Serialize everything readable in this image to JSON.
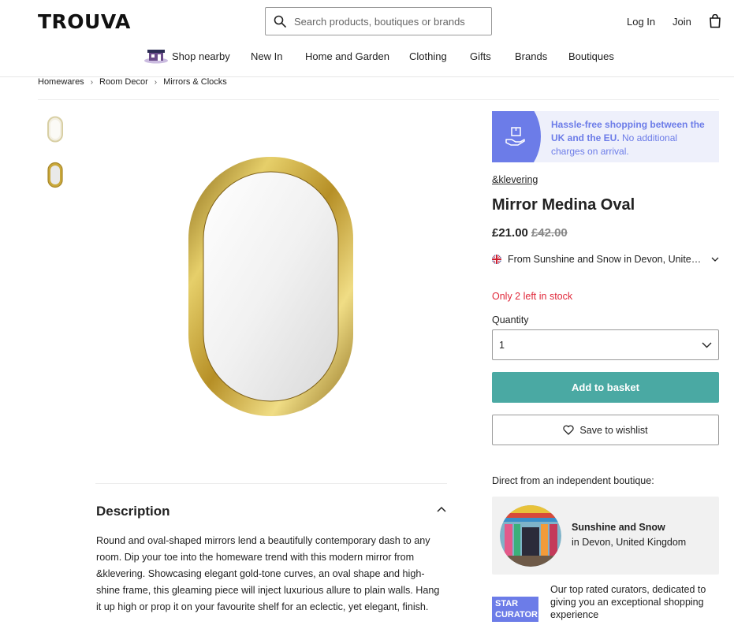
{
  "header": {
    "logo": "TROUVA",
    "search_placeholder": "Search products, boutiques or brands",
    "login": "Log In",
    "join": "Join"
  },
  "nav": {
    "items": [
      "Shop nearby",
      "New In",
      "Home and Garden",
      "Clothing",
      "Gifts",
      "Brands",
      "Boutiques"
    ]
  },
  "breadcrumb": [
    "Homewares",
    "Room Decor",
    "Mirrors & Clocks"
  ],
  "promo": {
    "bold": "Hassle-free shopping between the UK and the EU.",
    "rest": " No additional charges on arrival."
  },
  "product": {
    "brand": "&klevering",
    "title": "Mirror Medina Oval",
    "price": "£21.00",
    "old_price": "£42.00",
    "shipping": "From Sunshine and Snow in Devon, United Kingdom",
    "stock": "Only 2 left in stock",
    "quantity_label": "Quantity",
    "quantity_value": "1",
    "add_to_basket": "Add to basket",
    "save_to_wishlist": "Save to wishlist"
  },
  "description": {
    "title": "Description",
    "body": "Round and oval-shaped mirrors lend a beautifully contemporary dash to any room. Dip your toe into the homeware trend with this modern mirror from &klevering. Showcasing elegant gold-tone curves, an oval shape and high-shine frame, this gleaming piece will inject luxurious allure to plain walls. Hang it up high or prop it on your favourite shelf for an eclectic, yet elegant, finish."
  },
  "boutique": {
    "direct_label": "Direct from an independent boutique:",
    "name": "Sunshine and Snow",
    "location": "in Devon, United Kingdom"
  },
  "curator": {
    "badge_line1": "STAR",
    "badge_line2": "CURATOR",
    "text": "Our top rated curators, dedicated to giving you an exceptional shopping experience"
  },
  "colors": {
    "accent_purple": "#6c7ce8",
    "add_button": "#4aa9a3",
    "stock_red": "#e0283a",
    "gold": "#c9a83a"
  }
}
